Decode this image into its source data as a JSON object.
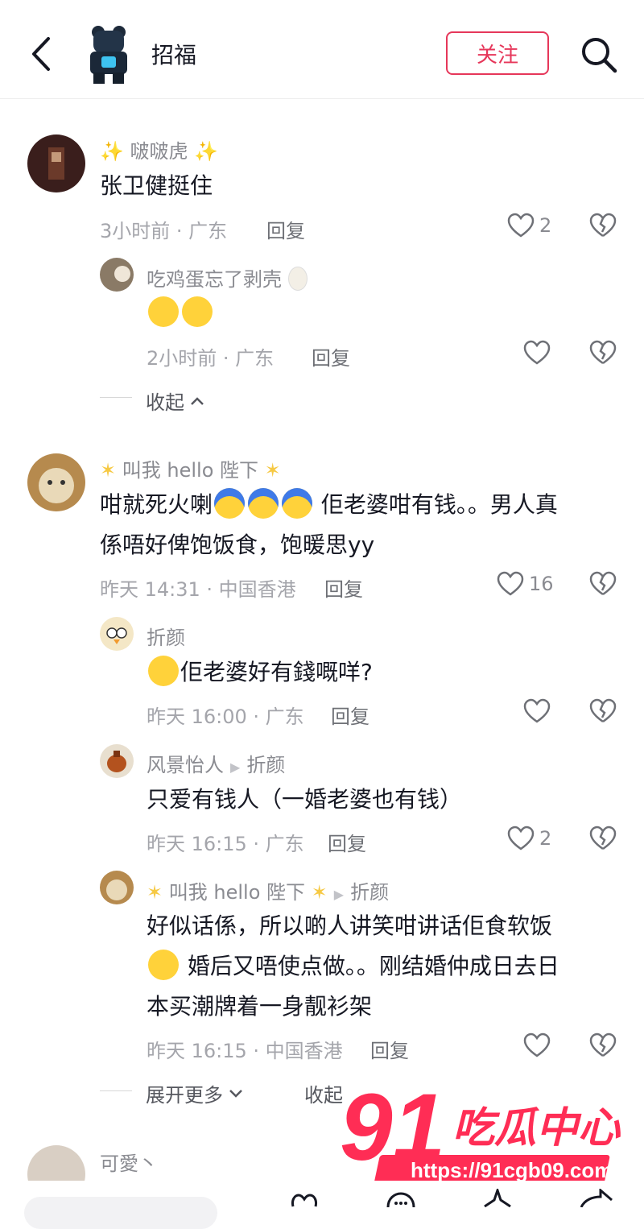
{
  "header": {
    "title": "招福",
    "follow_label": "关注"
  },
  "comments": [
    {
      "user": "✨ 啵啵虎 ✨",
      "text": "张卫健挺住",
      "meta": "3小时前 · 广东",
      "reply_label": "回复",
      "likes": "2",
      "replies": [
        {
          "user": "吃鸡蛋忘了剥壳",
          "text": "",
          "meta": "2小时前 · 广东",
          "reply_label": "回复",
          "likes": ""
        }
      ],
      "fold_label": "收起"
    },
    {
      "user": "叫我 hello 陛下",
      "text_line1_a": "咁就死火喇",
      "text_line1_b": "佢老婆咁有钱。。男人真",
      "text_line2": "係唔好俾饱饭食，饱暖思yy",
      "meta": "昨天 14:31 · 中国香港",
      "reply_label": "回复",
      "likes": "16",
      "replies": [
        {
          "user": "折颜",
          "text": "佢老婆好有錢嘅咩?",
          "meta": "昨天 16:00 · 广东",
          "reply_label": "回复",
          "likes": ""
        },
        {
          "user": "风景怡人",
          "reply_to": "折颜",
          "text": "只爱有钱人（一婚老婆也有钱）",
          "meta": "昨天 16:15 · 广东",
          "reply_label": "回复",
          "likes": "2"
        },
        {
          "user": "叫我 hello 陛下",
          "reply_to": "折颜",
          "text_line1": "好似话係，所以啲人讲笑咁讲话佢食软饭",
          "text_line2": "婚后又唔使点做。。刚结婚仲成日去日",
          "text_line3": "本买潮牌着一身靓衫架",
          "meta": "昨天 16:15 · 中国香港",
          "reply_label": "回复",
          "likes": ""
        }
      ],
      "expand_label": "展开更多",
      "fold_label": "收起"
    },
    {
      "user": "可愛丶"
    }
  ],
  "watermark": {
    "number": "91",
    "name": "吃瓜中心",
    "url": "https://91cgb09.com"
  },
  "colors": {
    "accent": "#e6375a",
    "text_primary": "#161823",
    "text_secondary": "#8a8b91"
  }
}
